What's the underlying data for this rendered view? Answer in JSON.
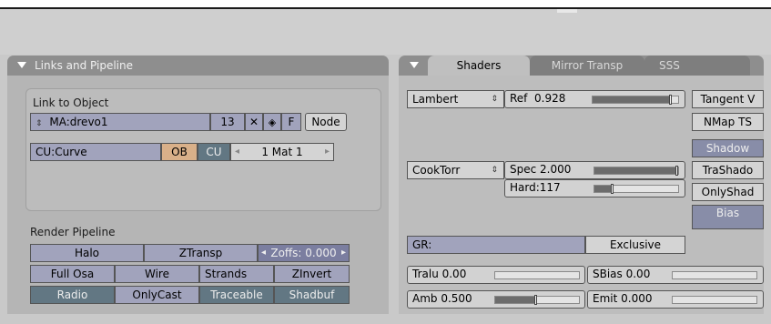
{
  "links_panel": {
    "title": "Links and Pipeline",
    "link_label": "Link to Object",
    "material_name": "MA:drevo1",
    "users_count": "13",
    "fake_user": "F",
    "node_label": "Node",
    "curve_name": "CU:Curve",
    "ob_label": "OB",
    "cu_label": "CU",
    "mat_slot": "1 Mat 1",
    "render_pipeline_label": "Render Pipeline",
    "pipeline_row1": [
      "Halo",
      "ZTransp",
      "Zoffs: 0.000"
    ],
    "pipeline_row2": [
      "Full Osa",
      "Wire",
      "Strands",
      "ZInvert"
    ],
    "pipeline_row3": [
      "Radio",
      "OnlyCast",
      "Traceable",
      "Shadbuf"
    ]
  },
  "shaders_panel": {
    "tabs": [
      "Shaders",
      "Mirror Transp",
      "SSS"
    ],
    "diffuse_shader": "Lambert",
    "ref": {
      "label": "Ref",
      "value": "0.928",
      "fraction": 0.928
    },
    "specular_shader": "CookTorr",
    "spec": {
      "label": "Spec 2.000",
      "fraction": 1.0
    },
    "hard": {
      "label": "Hard:117",
      "fraction": 0.23
    },
    "gr_label": "GR:",
    "exclusive_label": "Exclusive",
    "tralu": {
      "label": "Tralu 0.00",
      "fraction": 0.0
    },
    "amb": {
      "label": "Amb 0.500",
      "fraction": 0.5
    },
    "sbias": {
      "label": "SBias 0.00",
      "fraction": 0.0
    },
    "emit": {
      "label": "Emit 0.000",
      "fraction": 0.0
    },
    "side_buttons": [
      "Tangent V",
      "NMap TS",
      "Shadow",
      "TraShado",
      "OnlyShad",
      "Bias"
    ]
  },
  "colors": {
    "panel_header": "#8e8e8e",
    "panel_body": "#b5b5b5",
    "active_toggle": "#627783",
    "orange_toggle": "#d9b089"
  }
}
